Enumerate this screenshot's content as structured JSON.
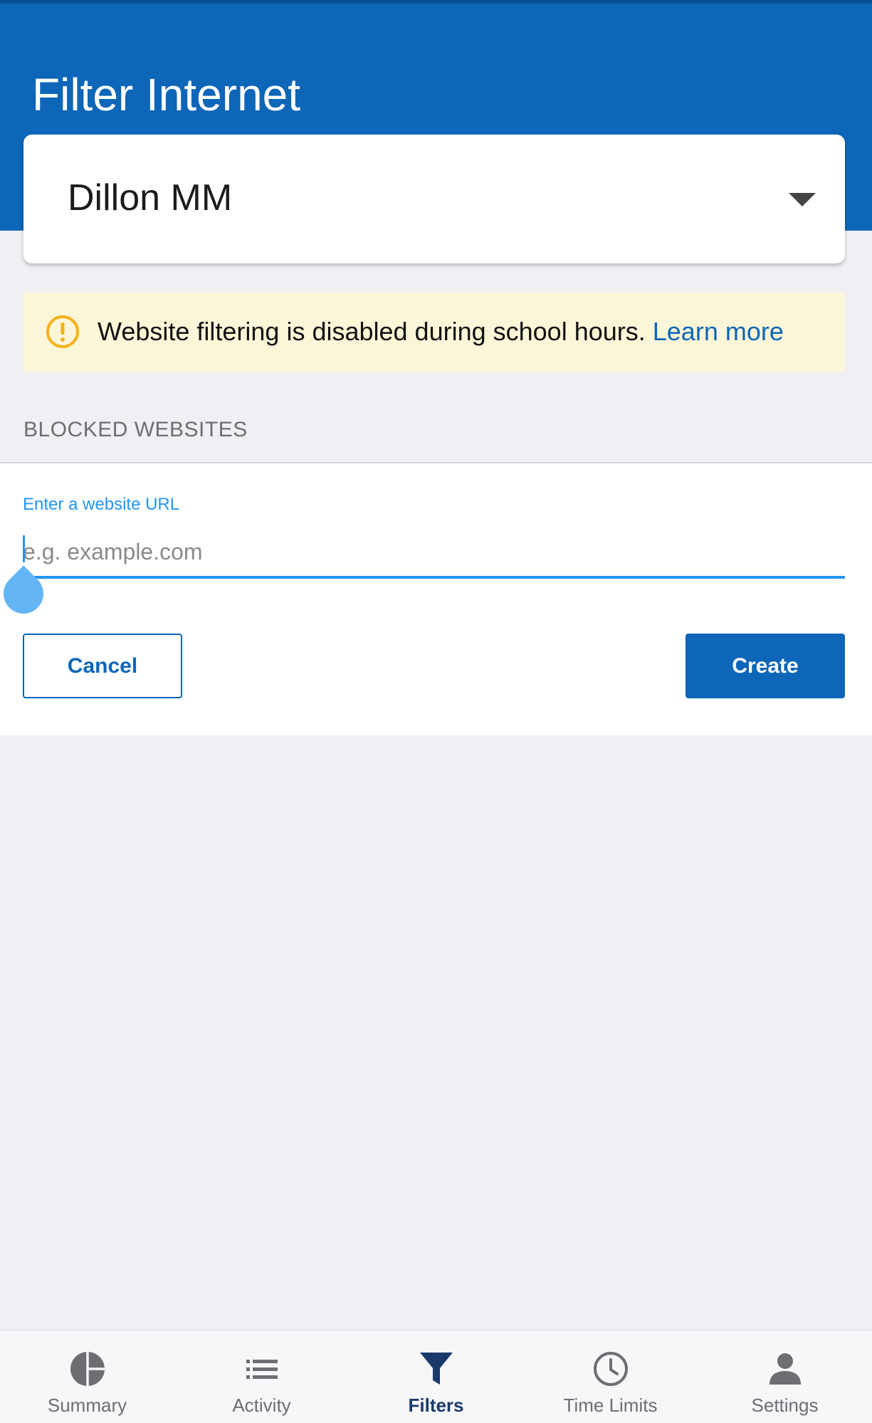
{
  "header": {
    "title": "Filter Internet"
  },
  "child_selector": {
    "selected": "Dillon MM"
  },
  "notice": {
    "icon": "warning-icon",
    "message": "Website filtering is disabled during school hours.",
    "link_label": "Learn more",
    "background_color": "#fcf6d8",
    "icon_color": "#f5b11a"
  },
  "blocked_websites": {
    "section_label": "BLOCKED WEBSITES",
    "form": {
      "field_label": "Enter a website URL",
      "value": "",
      "placeholder": "e.g. example.com",
      "cancel_label": "Cancel",
      "create_label": "Create"
    }
  },
  "bottom_nav": {
    "active": "Filters",
    "items": [
      {
        "label": "Summary",
        "icon": "pie-chart-icon"
      },
      {
        "label": "Activity",
        "icon": "list-icon"
      },
      {
        "label": "Filters",
        "icon": "funnel-icon"
      },
      {
        "label": "Time Limits",
        "icon": "clock-icon"
      },
      {
        "label": "Settings",
        "icon": "person-icon"
      }
    ]
  },
  "colors": {
    "primary": "#0d66b8",
    "accent": "#2196f3",
    "background": "#efeff4"
  }
}
